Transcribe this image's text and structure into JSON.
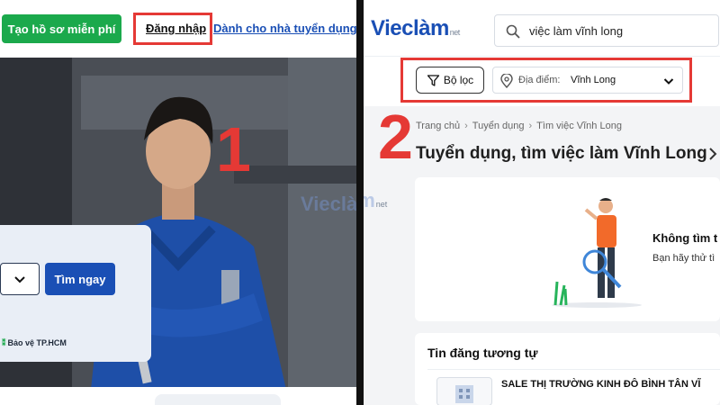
{
  "left": {
    "create_profile_label": "Tạo hồ sơ miễn phí",
    "login_label": "Đăng nhập",
    "employer_label": "Dành cho nhà tuyển dụng",
    "step_number": "1",
    "find_button_label": "Tìm ngay",
    "location_tag": "Bảo vệ TP.HCM"
  },
  "right": {
    "logo_main": "Vieclàm",
    "logo_suffix": "net",
    "search_query": "việc làm vĩnh long",
    "filter_label": "Bộ lọc",
    "location_label": "Địa điểm:",
    "location_value": "Vĩnh Long",
    "step_number": "2",
    "breadcrumb": [
      "Trang chủ",
      "Tuyển dụng",
      "Tìm việc Vĩnh Long"
    ],
    "page_title": "Tuyển dụng, tìm việc làm Vĩnh Long",
    "empty_title": "Không tìm t",
    "empty_subtitle": "Bạn hãy thử tì",
    "similar_heading": "Tin đăng tương tự",
    "job_titles": [
      "SALE THỊ TRƯỜNG KINH ĐÔ BÌNH TÂN VĨ"
    ]
  },
  "watermark": "Vieclàm",
  "watermark_suffix": "net",
  "colors": {
    "brand_blue": "#1a4fb5",
    "brand_green": "#1ba94c",
    "highlight_red": "#e53935"
  },
  "icons": [
    "search-icon",
    "filter-icon",
    "location-pin-icon",
    "chevron-down-icon",
    "chevron-right-icon"
  ]
}
